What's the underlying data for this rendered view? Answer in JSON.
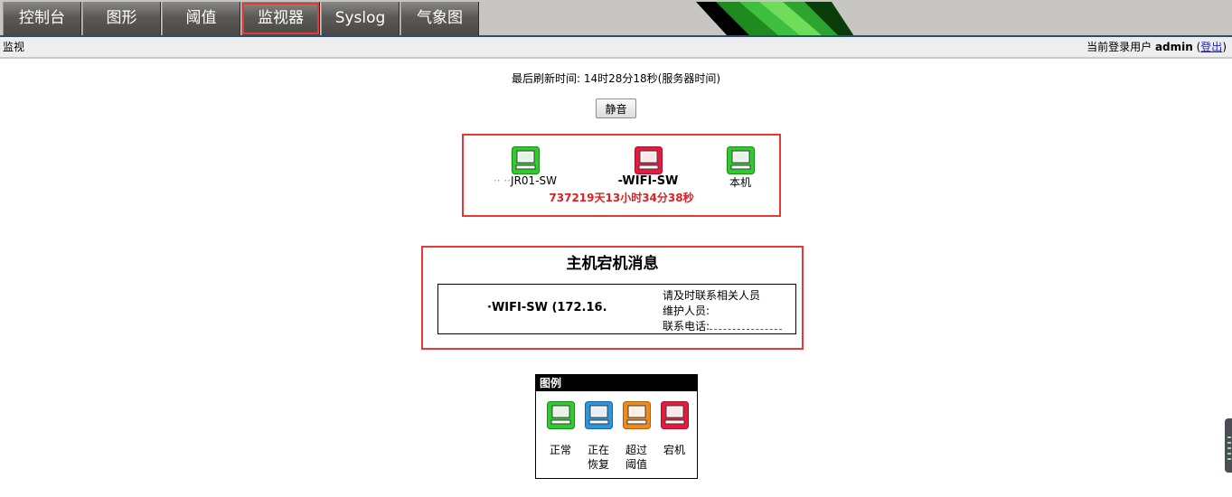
{
  "nav": {
    "tabs": [
      {
        "label": "控制台"
      },
      {
        "label": "图形"
      },
      {
        "label": "阈值"
      },
      {
        "label": "监视器"
      },
      {
        "label": "Syslog"
      },
      {
        "label": "气象图"
      }
    ],
    "active_tab": "监视器"
  },
  "breadcrumb": "监视",
  "user": {
    "prefix": "当前登录用户",
    "name": "admin",
    "open": " (",
    "logout": "登出",
    "close": ")"
  },
  "refresh_text": "最后刷新时间: 14时28分18秒(服务器时间)",
  "mute_button": "静音",
  "hosts": [
    {
      "label": "JR01-SW",
      "status": "normal"
    },
    {
      "label": "-WIFI-SW",
      "status": "down"
    },
    {
      "label": "本机",
      "status": "normal"
    }
  ],
  "downtime": "737219天13小时34分38秒",
  "message": {
    "title": "主机宕机消息",
    "host": "·WIFI-SW (172.16.",
    "contact_note": "请及时联系相关人员",
    "maintainer_label": "维护人员:",
    "phone_label": "联系电话:"
  },
  "legend": {
    "title": "图例",
    "items": [
      {
        "label": "正常",
        "status": "normal"
      },
      {
        "label": "正在恢复",
        "status": "recovering"
      },
      {
        "label": "超过阈值",
        "status": "threshold"
      },
      {
        "label": "宕机",
        "status": "down"
      }
    ]
  },
  "status_colors": {
    "normal": "#2fcc2f",
    "recovering": "#2b95e0",
    "threshold": "#f08a1c",
    "down": "#e8193f"
  }
}
